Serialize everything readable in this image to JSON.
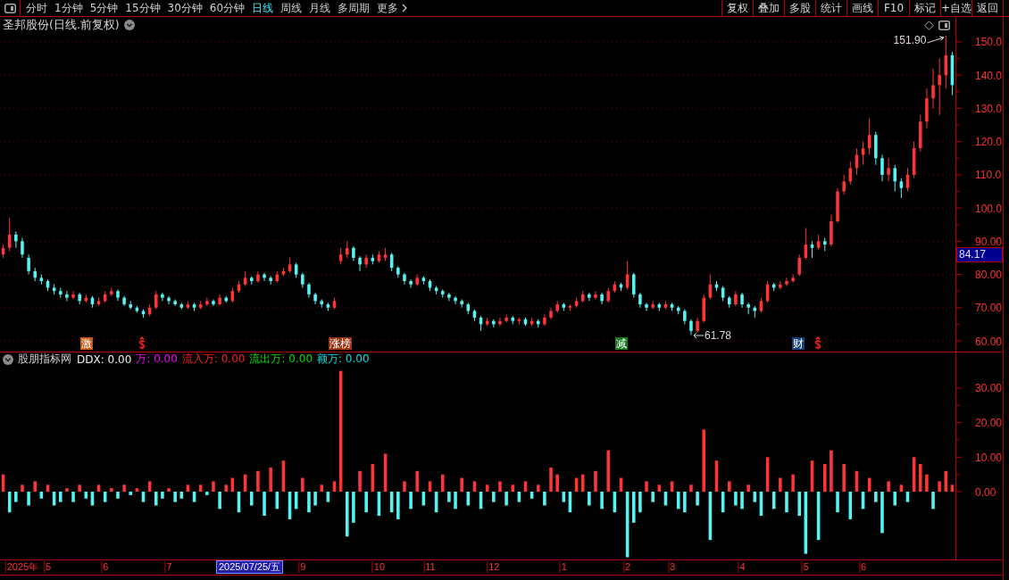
{
  "toolbar": {
    "periods": [
      {
        "label": "分时",
        "kind": "period",
        "selected": false
      },
      {
        "label": "1分钟",
        "kind": "period",
        "selected": false
      },
      {
        "label": "5分钟",
        "kind": "period",
        "selected": false
      },
      {
        "label": "15分钟",
        "kind": "period",
        "selected": false
      },
      {
        "label": "30分钟",
        "kind": "period",
        "selected": false
      },
      {
        "label": "60分钟",
        "kind": "period",
        "selected": false
      },
      {
        "label": "日线",
        "kind": "period",
        "selected": true
      },
      {
        "label": "周线",
        "kind": "period",
        "selected": false
      },
      {
        "label": "月线",
        "kind": "period",
        "selected": false
      },
      {
        "label": "多周期",
        "kind": "period",
        "selected": false
      },
      {
        "label": "更多",
        "kind": "menu",
        "selected": false
      }
    ],
    "actions": [
      "复权",
      "叠加",
      "多股",
      "统计",
      "画线",
      "F10",
      "标记",
      "+自选",
      "返回"
    ]
  },
  "crosshair": {
    "price": "84.17",
    "date": "2025/07/25/五"
  },
  "price_pane": {
    "title": "圣邦股份(日线.前复权)",
    "events": [
      {
        "kind": "tag",
        "label": "激",
        "color": "#c45a16"
      },
      {
        "kind": "dollar",
        "color": "#ff2020"
      },
      {
        "kind": "tag",
        "label": "涨榜",
        "color": "#9a3414"
      },
      {
        "kind": "tag",
        "label": "减",
        "color": "#187a1c"
      },
      {
        "kind": "tag",
        "label": "财",
        "color": "#16407a"
      },
      {
        "kind": "dollar",
        "color": "#ff2020"
      }
    ],
    "chart_data": [
      {
        "type": "candlestick",
        "ylim": [
          56.78,
          157.52
        ],
        "yticks": [
          {
            "value": 150,
            "label": "150.0"
          },
          {
            "value": 140,
            "label": "140.0"
          },
          {
            "value": 130,
            "label": "130.0"
          },
          {
            "value": 120,
            "label": "120.0"
          },
          {
            "value": 110,
            "label": "110.0"
          },
          {
            "value": 100,
            "label": "100.0"
          },
          {
            "value": 90,
            "label": "90.00"
          },
          {
            "value": 80,
            "label": "80.00"
          },
          {
            "value": 70,
            "label": "70.00"
          },
          {
            "value": 60,
            "label": "60.00"
          }
        ],
        "grid": true,
        "annotations": [
          "151.90",
          "61.78"
        ],
        "ohlc": [
          [
            86,
            89,
            85,
            88
          ],
          [
            88,
            97,
            87,
            92
          ],
          [
            92,
            93,
            88,
            90
          ],
          [
            90,
            91,
            85,
            86
          ],
          [
            85,
            86,
            80,
            81
          ],
          [
            81,
            82,
            78,
            79
          ],
          [
            79,
            80,
            77,
            78
          ],
          [
            78,
            78.5,
            75,
            76
          ],
          [
            76,
            77,
            74,
            75
          ],
          [
            75,
            76,
            73,
            74
          ],
          [
            74,
            75,
            72,
            73
          ],
          [
            73,
            75,
            72.5,
            74
          ],
          [
            74,
            74.5,
            71,
            72
          ],
          [
            72,
            74,
            71.5,
            73
          ],
          [
            73,
            73.5,
            70,
            71
          ],
          [
            71,
            73,
            70.5,
            72
          ],
          [
            72,
            75,
            71.5,
            74
          ],
          [
            74,
            76,
            73.5,
            75
          ],
          [
            75,
            75.5,
            72,
            73
          ],
          [
            73,
            73.5,
            70.5,
            71
          ],
          [
            71,
            72,
            69.5,
            70
          ],
          [
            70,
            70.5,
            68.5,
            69
          ],
          [
            69,
            69.5,
            67,
            68
          ],
          [
            68,
            71,
            67.5,
            70
          ],
          [
            70,
            75,
            69.5,
            74
          ],
          [
            74,
            74.5,
            72,
            73
          ],
          [
            73,
            73.5,
            71,
            72
          ],
          [
            72,
            72.5,
            70.5,
            71
          ],
          [
            71,
            71.5,
            69.5,
            70
          ],
          [
            70,
            72,
            69.5,
            71
          ],
          [
            71,
            71.5,
            69,
            70
          ],
          [
            70,
            72,
            69.5,
            71
          ],
          [
            71,
            73,
            70.5,
            72
          ],
          [
            72,
            72.5,
            70.5,
            71
          ],
          [
            71,
            74,
            70.5,
            73
          ],
          [
            73,
            73.5,
            71.5,
            72
          ],
          [
            72,
            76,
            71.5,
            75
          ],
          [
            75,
            78,
            74.5,
            77
          ],
          [
            77,
            81,
            76.5,
            79
          ],
          [
            79,
            79.5,
            77,
            78
          ],
          [
            78,
            81,
            77.5,
            80
          ],
          [
            80,
            80.5,
            78,
            79
          ],
          [
            79,
            79.5,
            77,
            78
          ],
          [
            78,
            81,
            77.5,
            80
          ],
          [
            80,
            82,
            79.5,
            81
          ],
          [
            81,
            85,
            80.5,
            83
          ],
          [
            83,
            83.5,
            79,
            80
          ],
          [
            80,
            80.5,
            76,
            77
          ],
          [
            77,
            77.5,
            73,
            74
          ],
          [
            74,
            74.5,
            71,
            72
          ],
          [
            72,
            72.5,
            70,
            71
          ],
          [
            71,
            71.5,
            69,
            70
          ],
          [
            70,
            73,
            69.5,
            72
          ],
          [
            84,
            88,
            83,
            86
          ],
          [
            86,
            90,
            85,
            88
          ],
          [
            88,
            88.5,
            84,
            85
          ],
          [
            85,
            85.5,
            81,
            83
          ],
          [
            83,
            86,
            82,
            85
          ],
          [
            85,
            86,
            83,
            84
          ],
          [
            84,
            87,
            83.5,
            86
          ],
          [
            85,
            88,
            84,
            86
          ],
          [
            86,
            86.5,
            81,
            82
          ],
          [
            82,
            82.5,
            79,
            80
          ],
          [
            80,
            80.5,
            77,
            78
          ],
          [
            78,
            78.5,
            76,
            77
          ],
          [
            77,
            80,
            76.5,
            79
          ],
          [
            79,
            79.5,
            77,
            78
          ],
          [
            78,
            78.5,
            75,
            76
          ],
          [
            76,
            76.5,
            74,
            75
          ],
          [
            75,
            75.5,
            73,
            74
          ],
          [
            74,
            74.5,
            72,
            73
          ],
          [
            73,
            73.5,
            71,
            72
          ],
          [
            72,
            72.5,
            70,
            71
          ],
          [
            71,
            71.5,
            68,
            69
          ],
          [
            69,
            69.5,
            66,
            67
          ],
          [
            67,
            67.5,
            63,
            65
          ],
          [
            65,
            67,
            64.5,
            66
          ],
          [
            66,
            66.5,
            64,
            65
          ],
          [
            65,
            67,
            64.5,
            66
          ],
          [
            66,
            68,
            65.5,
            67
          ],
          [
            67,
            67.5,
            65,
            66
          ],
          [
            66,
            67,
            65,
            66.5
          ],
          [
            66.5,
            67,
            64.5,
            65
          ],
          [
            65,
            67,
            64.5,
            66
          ],
          [
            66,
            66.5,
            64,
            65
          ],
          [
            65,
            68,
            64.5,
            67
          ],
          [
            67,
            70,
            66.5,
            69
          ],
          [
            69,
            72,
            68.5,
            71
          ],
          [
            71,
            71.5,
            69,
            70
          ],
          [
            70,
            71,
            69,
            70.5
          ],
          [
            70.5,
            73,
            70,
            72
          ],
          [
            72,
            75,
            71.5,
            74
          ],
          [
            74,
            74.5,
            72,
            73
          ],
          [
            73,
            75,
            72.5,
            74
          ],
          [
            74,
            74.5,
            71,
            72
          ],
          [
            72,
            76,
            71.5,
            75
          ],
          [
            75,
            78,
            74.5,
            77
          ],
          [
            77,
            77.5,
            75,
            76
          ],
          [
            76,
            84,
            75.5,
            80
          ],
          [
            80,
            80.5,
            73,
            74
          ],
          [
            74,
            74.5,
            70,
            71
          ],
          [
            71,
            71.5,
            69,
            70
          ],
          [
            70,
            72,
            69.5,
            71
          ],
          [
            71,
            71.5,
            69,
            70
          ],
          [
            70,
            72,
            69.5,
            71
          ],
          [
            71,
            71.5,
            69,
            70
          ],
          [
            70,
            70.5,
            68,
            69
          ],
          [
            69,
            69.5,
            65,
            66
          ],
          [
            66,
            66.5,
            61.78,
            63
          ],
          [
            63,
            67,
            62.5,
            66
          ],
          [
            66,
            74,
            65.5,
            73
          ],
          [
            73,
            80,
            72.5,
            77
          ],
          [
            77,
            78,
            75,
            76
          ],
          [
            76,
            76.5,
            72,
            73
          ],
          [
            73,
            73.5,
            70,
            71
          ],
          [
            71,
            75,
            70.5,
            74
          ],
          [
            74,
            74.5,
            70,
            71
          ],
          [
            71,
            71.5,
            68,
            70
          ],
          [
            70,
            70.5,
            67,
            69
          ],
          [
            69,
            73,
            68.5,
            72
          ],
          [
            72,
            78,
            71.5,
            77
          ],
          [
            77,
            77.5,
            75,
            76
          ],
          [
            76,
            78,
            75.5,
            77
          ],
          [
            77,
            79,
            76.5,
            78
          ],
          [
            78,
            80,
            77.5,
            79
          ],
          [
            80,
            86,
            79.5,
            85
          ],
          [
            85,
            94,
            84.5,
            89
          ],
          [
            89,
            90,
            85,
            88
          ],
          [
            88,
            92,
            87.5,
            90
          ],
          [
            90,
            91,
            87,
            89
          ],
          [
            89,
            98,
            88.5,
            96
          ],
          [
            96,
            106,
            95.5,
            105
          ],
          [
            105,
            110,
            104,
            108
          ],
          [
            108,
            114,
            107,
            112
          ],
          [
            112,
            118,
            110,
            116
          ],
          [
            116,
            120,
            113,
            118
          ],
          [
            118,
            127,
            116,
            122
          ],
          [
            122,
            123,
            113,
            115
          ],
          [
            115,
            116,
            108,
            110
          ],
          [
            110,
            115,
            108,
            112
          ],
          [
            112,
            113,
            105,
            108
          ],
          [
            108,
            109,
            103,
            106
          ],
          [
            106,
            112,
            105,
            110
          ],
          [
            110,
            120,
            109,
            118
          ],
          [
            118,
            128,
            117,
            126
          ],
          [
            126,
            136,
            124,
            133
          ],
          [
            133,
            142,
            130,
            137
          ],
          [
            137,
            145,
            128,
            140
          ],
          [
            140,
            151.9,
            136,
            146
          ],
          [
            146,
            147,
            134,
            137
          ]
        ]
      }
    ]
  },
  "indicator_pane": {
    "title": "股朋指标网",
    "readouts": [
      {
        "text": "DDX: 0.00",
        "color": "#f0f0f0"
      },
      {
        "text": "万: 0.00",
        "color": "#ff00ff"
      },
      {
        "text": "流入万: 0.00",
        "color": "#ff2020"
      },
      {
        "text": "流出万: 0.00",
        "color": "#00e000"
      },
      {
        "text": "额万: 0.00",
        "color": "#00e0e0"
      }
    ],
    "chart_data": [
      {
        "type": "bar",
        "ylim": [
          -19.65,
          40.34
        ],
        "yticks": [
          {
            "value": 30,
            "label": "30.00"
          },
          {
            "value": 20,
            "label": "20.00"
          },
          {
            "value": 10,
            "label": "10.00"
          },
          {
            "value": 0,
            "label": "0.00"
          }
        ],
        "categories": [
          null,
          null,
          null,
          "2025年",
          null,
          null,
          null,
          "5",
          null,
          null,
          null,
          null,
          null,
          null,
          null,
          null,
          "6",
          null,
          null,
          null,
          null,
          null,
          null,
          null,
          null,
          null,
          "7",
          null,
          null,
          null,
          null,
          null,
          null,
          null,
          null,
          null,
          null,
          null,
          null,
          null,
          null,
          null,
          null,
          null,
          null,
          null,
          null,
          "9",
          null,
          null,
          null,
          null,
          null,
          null,
          null,
          null,
          null,
          null,
          null,
          "10",
          null,
          null,
          null,
          null,
          null,
          null,
          null,
          "11",
          null,
          null,
          null,
          null,
          null,
          null,
          null,
          null,
          null,
          "12",
          null,
          null,
          null,
          null,
          null,
          null,
          null,
          null,
          null,
          null,
          "1",
          null,
          null,
          null,
          null,
          null,
          null,
          null,
          null,
          null,
          "2",
          null,
          null,
          null,
          null,
          null,
          null,
          "3",
          null,
          null,
          null,
          null,
          null,
          null,
          null,
          null,
          null,
          null,
          "4",
          null,
          null,
          null,
          null,
          null,
          null,
          null,
          null,
          null,
          "5",
          null,
          null,
          null,
          null,
          null,
          null,
          null,
          null,
          "6",
          null,
          null,
          null,
          null,
          null,
          null,
          null,
          null,
          null,
          null,
          null,
          null,
          null,
          null
        ],
        "values": [
          5,
          -6,
          -3,
          2,
          -4,
          3,
          -2,
          2,
          -4,
          -3,
          1,
          -3,
          2,
          -2,
          -4,
          2,
          -3,
          1,
          -2,
          2,
          -1,
          1,
          -3,
          3,
          -4,
          -2,
          1,
          -3,
          -2,
          2,
          -3,
          2,
          -1,
          3,
          -5,
          2,
          4,
          -6,
          5,
          -4,
          6,
          -7,
          7,
          -5,
          9,
          -8,
          -5,
          4,
          -6,
          -4,
          2,
          -3,
          3,
          35,
          -13,
          -9,
          6,
          -6,
          8,
          -7,
          11,
          -6,
          -8,
          3,
          -5,
          6,
          -4,
          3,
          -6,
          5,
          -3,
          -5,
          4,
          -4,
          3,
          -5,
          2,
          -3,
          3,
          -4,
          2,
          -3,
          3,
          -2,
          2,
          -4,
          7,
          5,
          -3,
          -6,
          4,
          5,
          -4,
          6,
          -5,
          12,
          -6,
          4,
          -19,
          -9,
          -6,
          3,
          -3,
          2,
          -4,
          3,
          -5,
          -6,
          2,
          -4,
          18,
          -14,
          9,
          -6,
          3,
          -4,
          -5,
          2,
          -3,
          -7,
          10,
          -5,
          4,
          -6,
          5,
          -7,
          -18,
          9,
          -14,
          8,
          12,
          -6,
          8,
          -8,
          6,
          -5,
          4,
          -3,
          -12,
          3,
          -4,
          2,
          -3,
          10,
          8,
          5,
          -5,
          3,
          6,
          2
        ]
      }
    ]
  }
}
